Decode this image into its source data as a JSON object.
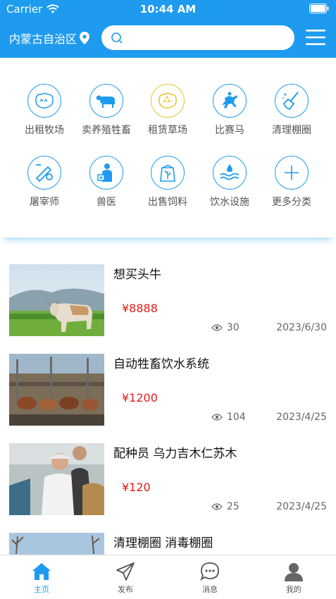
{
  "status": {
    "carrier": "Carrier",
    "time": "10:44 AM"
  },
  "header": {
    "location": "内蒙古自治区",
    "search_placeholder": ""
  },
  "categories": [
    {
      "label": "出租牧场",
      "icon": "pasture-icon"
    },
    {
      "label": "卖养殖牲畜",
      "icon": "cattle-icon"
    },
    {
      "label": "租赁草场",
      "icon": "grassland-icon"
    },
    {
      "label": "比赛马",
      "icon": "horse-racing-icon"
    },
    {
      "label": "清理棚圈",
      "icon": "cleaning-icon"
    },
    {
      "label": "屠宰师",
      "icon": "butcher-icon"
    },
    {
      "label": "兽医",
      "icon": "veterinarian-icon"
    },
    {
      "label": "出售饲料",
      "icon": "feed-icon"
    },
    {
      "label": "饮水设施",
      "icon": "water-facility-icon"
    },
    {
      "label": "更多分类",
      "icon": "plus-icon"
    }
  ],
  "listings": [
    {
      "title": "想买头牛",
      "price": "¥8888",
      "views": "30",
      "date": "2023/6/30"
    },
    {
      "title": "自动牲畜饮水系统",
      "price": "¥1200",
      "views": "104",
      "date": "2023/4/25"
    },
    {
      "title": "配种员 乌力吉木仁苏木",
      "price": "¥120",
      "views": "25",
      "date": "2023/4/25"
    },
    {
      "title": "清理棚圈 消毒棚圈"
    }
  ],
  "tabs": [
    {
      "label": "主页",
      "active": true
    },
    {
      "label": "发布"
    },
    {
      "label": "消息"
    },
    {
      "label": "我的"
    }
  ],
  "colors": {
    "primary": "#1E9BEF",
    "price": "#E21B1B",
    "accent_yellow": "#E5C42B"
  }
}
